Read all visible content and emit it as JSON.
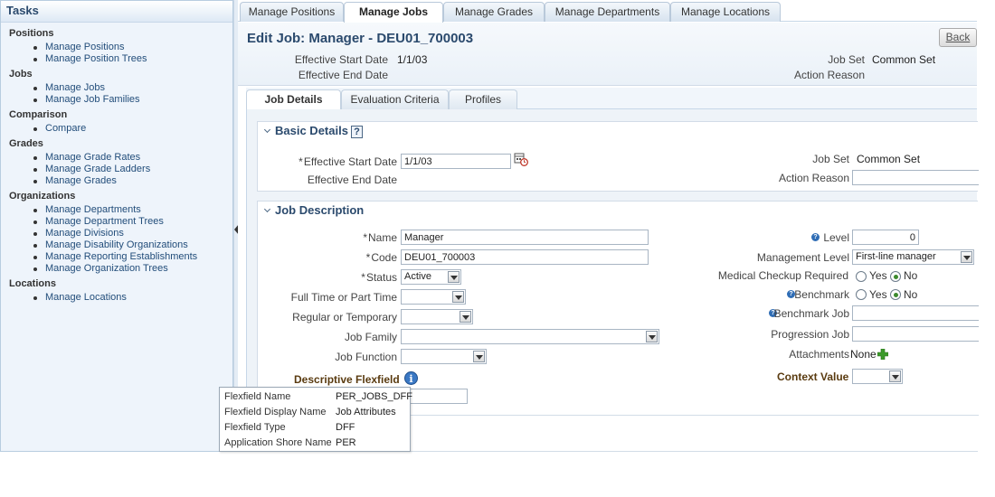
{
  "taskpane": {
    "title": "Tasks",
    "groups": [
      {
        "title": "Positions",
        "items": [
          "Manage Positions",
          "Manage Position Trees"
        ]
      },
      {
        "title": "Jobs",
        "items": [
          "Manage Jobs",
          "Manage Job Families"
        ]
      },
      {
        "title": "Comparison",
        "items": [
          "Compare"
        ]
      },
      {
        "title": "Grades",
        "items": [
          "Manage Grade Rates",
          "Manage Grade Ladders",
          "Manage Grades"
        ]
      },
      {
        "title": "Organizations",
        "items": [
          "Manage Departments",
          "Manage Department Trees",
          "Manage Divisions",
          "Manage Disability Organizations",
          "Manage Reporting Establishments",
          "Manage Organization Trees"
        ]
      },
      {
        "title": "Locations",
        "items": [
          "Manage Locations"
        ]
      }
    ]
  },
  "top_tabs": [
    "Manage Positions",
    "Manage Jobs",
    "Manage Grades",
    "Manage Departments",
    "Manage Locations"
  ],
  "active_top_tab": "Manage Jobs",
  "header": {
    "title": "Edit Job: Manager - DEU01_700003",
    "back_label": "Back",
    "eff_start_label": "Effective Start Date",
    "eff_start_value": "1/1/03",
    "eff_end_label": "Effective End Date",
    "job_set_label": "Job Set",
    "job_set_value": "Common Set",
    "action_reason_label": "Action Reason"
  },
  "sub_tabs": [
    "Job Details",
    "Evaluation Criteria",
    "Profiles"
  ],
  "active_sub_tab": "Job Details",
  "basic": {
    "title": "Basic Details",
    "help": "?",
    "req_mark": "*",
    "eff_start_label": "Effective Start Date",
    "eff_start_value": "1/1/03",
    "eff_end_label": "Effective End Date",
    "job_set_label": "Job Set",
    "job_set_value": "Common Set",
    "action_reason_label": "Action Reason",
    "action_reason_value": ""
  },
  "description": {
    "title": "Job Description",
    "req_mark": "*",
    "name_label": "Name",
    "name_value": "Manager",
    "code_label": "Code",
    "code_value": "DEU01_700003",
    "status_label": "Status",
    "status_value": "Active",
    "full_time_label": "Full Time or Part Time",
    "full_time_value": "",
    "regular_label": "Regular or Temporary",
    "regular_value": "",
    "job_family_label": "Job Family",
    "job_family_value": "",
    "job_function_label": "Job Function",
    "job_function_value": "",
    "level_label": "Level",
    "level_value": "0",
    "mgmt_level_label": "Management Level",
    "mgmt_level_value": "First-line manager",
    "medical_label": "Medical Checkup Required",
    "yes_label": "Yes",
    "no_label": "No",
    "medical_selected": "No",
    "benchmark_label": "Benchmark",
    "benchmark_selected": "No",
    "benchmark_job_label": "Benchmark Job",
    "benchmark_job_value": "",
    "progression_label": "Progression Job",
    "progression_value": "",
    "attachments_label": "Attachments",
    "attachments_value": "None",
    "help_q": "?",
    "flexfield_label": "Descriptive Flexfield",
    "context_label": "Context Value",
    "context_value": ""
  },
  "tooltip": {
    "rows": [
      {
        "label": "Flexfield Name",
        "value": "PER_JOBS_DFF"
      },
      {
        "label": "Flexfield Display Name",
        "value": "Job Attributes"
      },
      {
        "label": "Flexfield Type",
        "value": "DFF"
      },
      {
        "label": "Application Shore Name",
        "value": "PER"
      }
    ]
  },
  "icons": {
    "calendar": "calendar-icon",
    "info": "info-icon",
    "add": "add-icon",
    "help": "help-icon",
    "collapse": "chevron-down-icon"
  },
  "colors": {
    "title_blue": "#2b4a6d",
    "link_blue": "#224d7a",
    "flexfield_brown": "#5a3b10",
    "radio_green": "#3d8a2e"
  }
}
